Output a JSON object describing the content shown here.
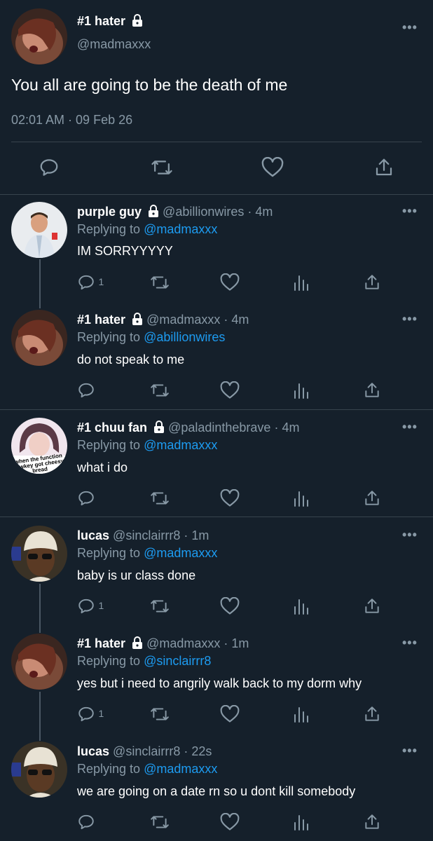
{
  "main_tweet": {
    "display_name": "#1 hater",
    "handle": "@madmaxxx",
    "text": "You all are going to be the death of me",
    "timestamp": "02:01 AM · 09 Feb 26",
    "more_label": "•••"
  },
  "replies": [
    {
      "display_name": "purple guy",
      "handle": "@abillionwires",
      "time": "· 4m",
      "replying_prefix": "Replying to",
      "replying_to": "@madmaxxx",
      "text": "IM SORRYYYYY",
      "reply_count": "1",
      "more_label": "•••"
    },
    {
      "display_name": "#1 hater",
      "handle": "@madmaxxx",
      "time": "· 4m",
      "replying_prefix": "Replying to",
      "replying_to": "@abillionwires",
      "text": "do not speak to me",
      "reply_count": "",
      "more_label": "•••"
    },
    {
      "display_name": "#1 chuu fan",
      "handle": "@paladinthebrave",
      "time": "· 4m",
      "replying_prefix": "Replying to",
      "replying_to": "@madmaxxx",
      "text": "what i do",
      "reply_count": "",
      "avatar_caption": "when the function lowkey got cheesy bread",
      "more_label": "•••"
    },
    {
      "display_name": "lucas",
      "handle": "@sinclairrr8",
      "time": "· 1m",
      "replying_prefix": "Replying to",
      "replying_to": "@madmaxxx",
      "text": "baby is ur class done",
      "reply_count": "1",
      "more_label": "•••"
    },
    {
      "display_name": "#1 hater",
      "handle": "@madmaxxx",
      "time": "· 1m",
      "replying_prefix": "Replying to",
      "replying_to": "@sinclairrr8",
      "text": "yes but i need to angrily walk back to my dorm why",
      "reply_count": "1",
      "more_label": "•••"
    },
    {
      "display_name": "lucas",
      "handle": "@sinclairrr8",
      "time": "· 22s",
      "replying_prefix": "Replying to",
      "replying_to": "@madmaxxx",
      "text": "we are going on a date rn so u dont kill somebody",
      "reply_count": "",
      "more_label": "•••"
    }
  ],
  "colors": {
    "background": "#15202b",
    "muted": "#8899a6",
    "link": "#1d9bf0",
    "divider": "#38444d"
  }
}
